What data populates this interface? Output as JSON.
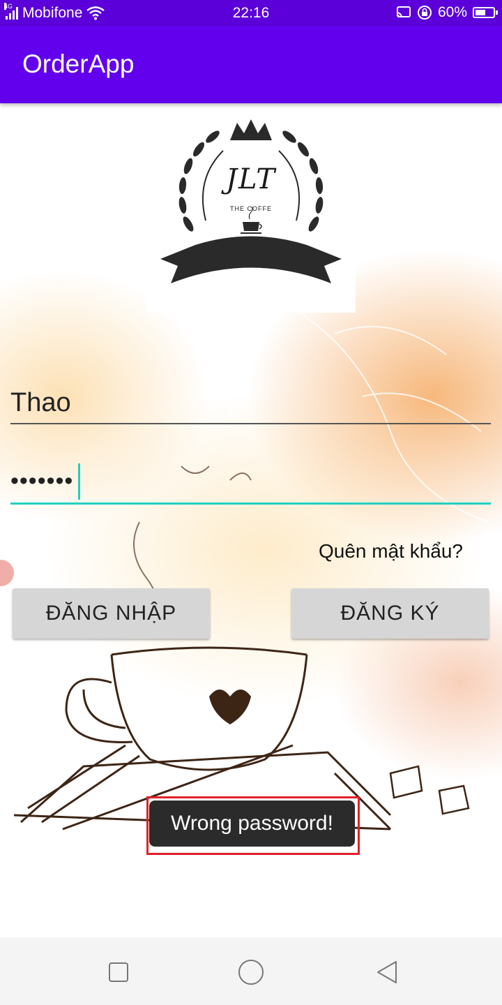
{
  "status_bar": {
    "network_type": "4G",
    "carrier": "Mobifone",
    "time": "22:16",
    "battery_percent": "60%",
    "battery_level": 0.6,
    "icons": [
      "signal-icon",
      "wifi-icon",
      "cast-icon",
      "rotation-lock-icon",
      "battery-icon"
    ]
  },
  "app_bar": {
    "title": "OrderApp"
  },
  "logo": {
    "monogram": "JLT",
    "tagline": "THE COFFE"
  },
  "login_form": {
    "username_value": "Thao",
    "password_masked": "•••••••",
    "forgot_link": "Quên mật khẩu?",
    "login_button": "ĐĂNG NHẬP",
    "register_button": "ĐĂNG KÝ"
  },
  "toast": {
    "message": "Wrong password!"
  },
  "nav_bar": {
    "icons": [
      "recents-square-icon",
      "home-circle-icon",
      "back-triangle-icon"
    ]
  },
  "colors": {
    "primary": "#6200ee",
    "status_bar": "#5b00d9",
    "accent": "#1fd0c1",
    "highlight": "#e0202a"
  }
}
